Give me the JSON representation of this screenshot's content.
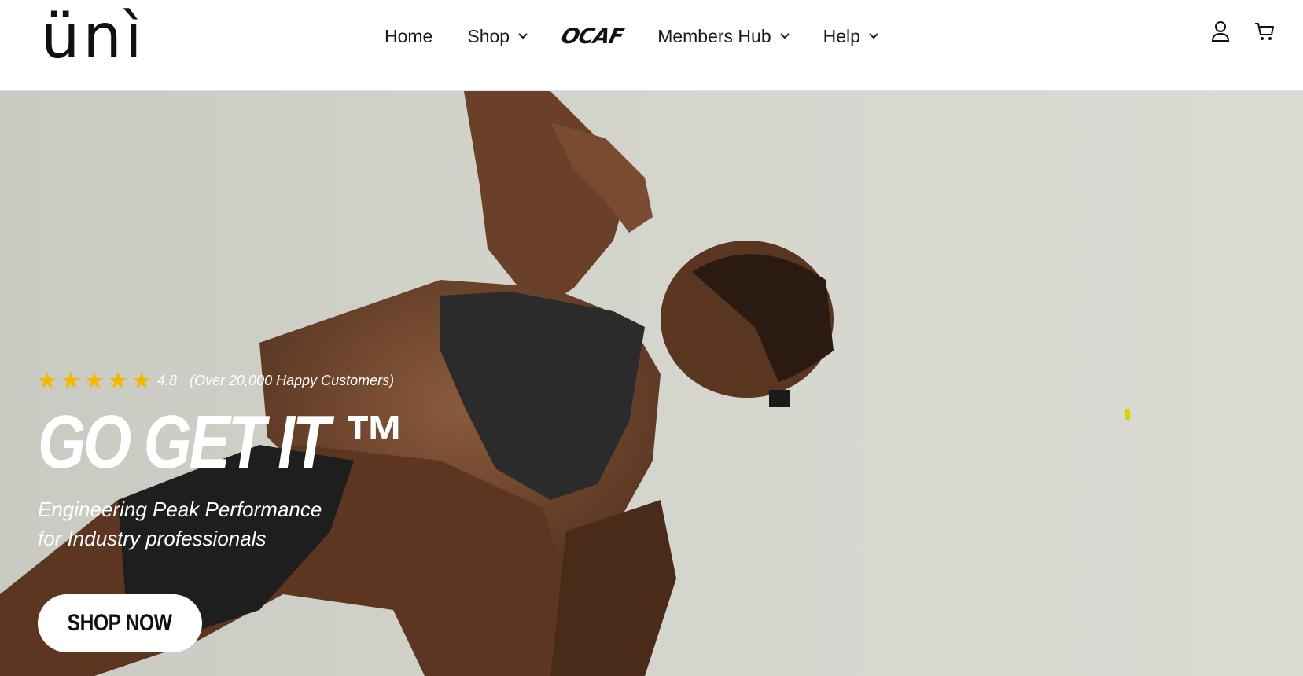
{
  "brand": {
    "logo_text": "ünì"
  },
  "nav": {
    "items": [
      {
        "label": "Home",
        "has_dropdown": false
      },
      {
        "label": "Shop",
        "has_dropdown": true
      },
      {
        "label": "OCAF",
        "has_dropdown": false,
        "style": "logo"
      },
      {
        "label": "Members Hub",
        "has_dropdown": true
      },
      {
        "label": "Help",
        "has_dropdown": true
      }
    ]
  },
  "header_icons": [
    {
      "name": "account-icon"
    },
    {
      "name": "cart-icon"
    }
  ],
  "hero": {
    "rating": {
      "stars": 5,
      "score": "4.8",
      "note": "(Over 20,000 Happy Customers)",
      "star_color": "#f5b800"
    },
    "headline": "GO GET IT ™",
    "subline_1": "Engineering Peak Performance",
    "subline_2": "for Industry professionals",
    "cta_label": "SHOP NOW"
  },
  "colors": {
    "hero_bg": "#d7d7cf",
    "accent_marker": "#d4d400",
    "text_on_hero": "#ffffff"
  }
}
